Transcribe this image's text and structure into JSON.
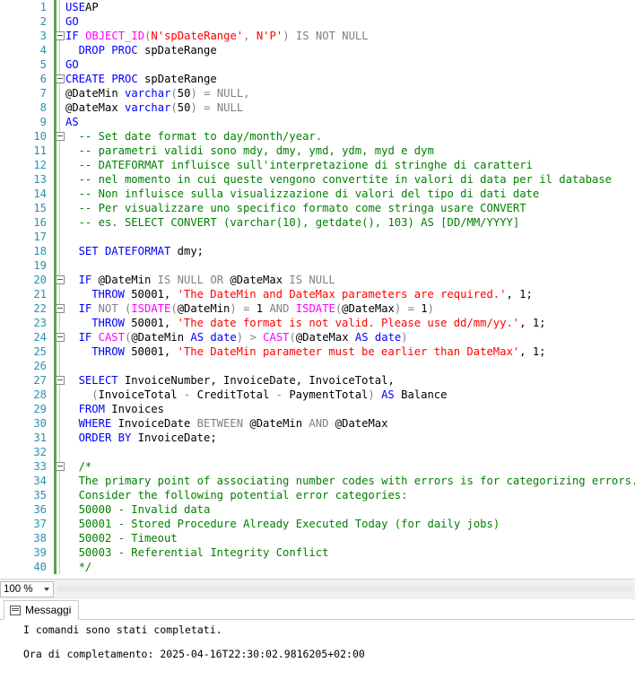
{
  "editor": {
    "lines": [
      {
        "num": "1",
        "fold": false,
        "segments": [
          [
            "kw",
            "USE"
          ],
          [
            "",
            "AP"
          ]
        ]
      },
      {
        "num": "2",
        "fold": false,
        "segments": [
          [
            "kw",
            "GO"
          ]
        ]
      },
      {
        "num": "3",
        "fold": true,
        "segments": [
          [
            "kw",
            "IF"
          ],
          [
            "",
            " "
          ],
          [
            "fn",
            "OBJECT_ID"
          ],
          [
            "gr",
            "("
          ],
          [
            "str",
            "N'spDateRange'"
          ],
          [
            "gr",
            ", "
          ],
          [
            "str",
            "N'P'"
          ],
          [
            "gr",
            ")"
          ],
          [
            "",
            " "
          ],
          [
            "gr",
            "IS NOT NULL"
          ]
        ]
      },
      {
        "num": "4",
        "fold": false,
        "segments": [
          [
            "",
            " "
          ],
          [
            "kw",
            "DROP PROC"
          ],
          [
            "",
            " spDateRange"
          ]
        ]
      },
      {
        "num": "5",
        "fold": false,
        "segments": [
          [
            "kw",
            "GO"
          ]
        ]
      },
      {
        "num": "6",
        "fold": true,
        "segments": [
          [
            "kw",
            "CREATE PROC"
          ],
          [
            "",
            " spDateRange"
          ]
        ]
      },
      {
        "num": "7",
        "fold": false,
        "segments": [
          [
            "",
            "@DateMin "
          ],
          [
            "kw",
            "varchar"
          ],
          [
            "gr",
            "("
          ],
          [
            "",
            "50"
          ],
          [
            "gr",
            ")"
          ],
          [
            "",
            " "
          ],
          [
            "gr",
            "="
          ],
          [
            "",
            " "
          ],
          [
            "gr",
            "NULL,"
          ]
        ]
      },
      {
        "num": "8",
        "fold": false,
        "segments": [
          [
            "",
            "@DateMax "
          ],
          [
            "kw",
            "varchar"
          ],
          [
            "gr",
            "("
          ],
          [
            "",
            "50"
          ],
          [
            "gr",
            ")"
          ],
          [
            "",
            " "
          ],
          [
            "gr",
            "="
          ],
          [
            "",
            " "
          ],
          [
            "gr",
            "NULL"
          ]
        ]
      },
      {
        "num": "9",
        "fold": false,
        "segments": [
          [
            "kw",
            "AS"
          ]
        ]
      },
      {
        "num": "10",
        "fold": true,
        "segments": [
          [
            "cm",
            " -- Set date format to day/month/year."
          ]
        ]
      },
      {
        "num": "11",
        "fold": false,
        "segments": [
          [
            "cm",
            " -- parametri validi sono mdy, dmy, ymd, ydm, myd e dym"
          ]
        ]
      },
      {
        "num": "12",
        "fold": false,
        "segments": [
          [
            "cm",
            " -- DATEFORMAT influisce sull'interpretazione di stringhe di caratteri"
          ]
        ]
      },
      {
        "num": "13",
        "fold": false,
        "segments": [
          [
            "cm",
            " -- nel momento in cui queste vengono convertite in valori di data per il database"
          ]
        ]
      },
      {
        "num": "14",
        "fold": false,
        "segments": [
          [
            "cm",
            " -- Non influisce sulla visualizzazione di valori del tipo di dati date"
          ]
        ]
      },
      {
        "num": "15",
        "fold": false,
        "segments": [
          [
            "cm",
            " -- Per visualizzare uno specifico formato come stringa usare CONVERT"
          ]
        ]
      },
      {
        "num": "16",
        "fold": false,
        "segments": [
          [
            "cm",
            " -- es. SELECT CONVERT (varchar(10), getdate(), 103) AS [DD/MM/YYYY]"
          ]
        ]
      },
      {
        "num": "17",
        "fold": false,
        "segments": []
      },
      {
        "num": "18",
        "fold": false,
        "segments": [
          [
            "",
            " "
          ],
          [
            "kw",
            "SET DATEFORMAT"
          ],
          [
            "",
            " dmy;"
          ]
        ]
      },
      {
        "num": "19",
        "fold": false,
        "segments": []
      },
      {
        "num": "20",
        "fold": true,
        "segments": [
          [
            "",
            " "
          ],
          [
            "kw",
            "IF"
          ],
          [
            "",
            " @DateMin "
          ],
          [
            "gr",
            "IS NULL OR"
          ],
          [
            "",
            " @DateMax "
          ],
          [
            "gr",
            "IS NULL"
          ]
        ]
      },
      {
        "num": "21",
        "fold": false,
        "segments": [
          [
            "",
            " "
          ],
          [
            "kw",
            "THROW"
          ],
          [
            "",
            " 50001, "
          ],
          [
            "str",
            "'The DateMin and DateMax parameters are required.'"
          ],
          [
            "",
            ", 1;"
          ]
        ]
      },
      {
        "num": "22",
        "fold": true,
        "segments": [
          [
            "",
            " "
          ],
          [
            "kw",
            "IF"
          ],
          [
            "",
            " "
          ],
          [
            "gr",
            "NOT ("
          ],
          [
            "fn",
            "ISDATE"
          ],
          [
            "gr",
            "("
          ],
          [
            "",
            "@DateMin"
          ],
          [
            "gr",
            ")"
          ],
          [
            "",
            " "
          ],
          [
            "gr",
            "="
          ],
          [
            "",
            " 1 "
          ],
          [
            "gr",
            "AND"
          ],
          [
            "",
            " "
          ],
          [
            "fn",
            "ISDATE"
          ],
          [
            "gr",
            "("
          ],
          [
            "",
            "@DateMax"
          ],
          [
            "gr",
            ")"
          ],
          [
            "",
            " "
          ],
          [
            "gr",
            "="
          ],
          [
            "",
            " 1"
          ],
          [
            "gr",
            ")"
          ]
        ]
      },
      {
        "num": "23",
        "fold": false,
        "segments": [
          [
            "",
            " "
          ],
          [
            "kw",
            "THROW"
          ],
          [
            "",
            " 50001, "
          ],
          [
            "str",
            "'The date format is not valid. Please use dd/mm/yy.'"
          ],
          [
            "",
            ", 1;"
          ]
        ]
      },
      {
        "num": "24",
        "fold": true,
        "segments": [
          [
            "",
            " "
          ],
          [
            "kw",
            "IF"
          ],
          [
            "",
            " "
          ],
          [
            "fn",
            "CAST"
          ],
          [
            "gr",
            "("
          ],
          [
            "",
            "@DateMin "
          ],
          [
            "kw",
            "AS"
          ],
          [
            "",
            " "
          ],
          [
            "kw",
            "date"
          ],
          [
            "gr",
            ")"
          ],
          [
            "",
            " "
          ],
          [
            "gr",
            ">"
          ],
          [
            "",
            " "
          ],
          [
            "fn",
            "CAST"
          ],
          [
            "gr",
            "("
          ],
          [
            "",
            "@DateMax "
          ],
          [
            "kw",
            "AS"
          ],
          [
            "",
            " "
          ],
          [
            "kw",
            "date"
          ],
          [
            "gr",
            ")"
          ]
        ]
      },
      {
        "num": "25",
        "fold": false,
        "segments": [
          [
            "",
            " "
          ],
          [
            "kw",
            "THROW"
          ],
          [
            "",
            " 50001, "
          ],
          [
            "str",
            "'The DateMin parameter must be earlier than DateMax'"
          ],
          [
            "",
            ", 1;"
          ]
        ]
      },
      {
        "num": "26",
        "fold": false,
        "segments": []
      },
      {
        "num": "27",
        "fold": true,
        "segments": [
          [
            "",
            " "
          ],
          [
            "kw",
            "SELECT"
          ],
          [
            "",
            " InvoiceNumber, InvoiceDate, InvoiceTotal,"
          ]
        ]
      },
      {
        "num": "28",
        "fold": false,
        "segments": [
          [
            "",
            " "
          ],
          [
            "gr",
            "("
          ],
          [
            "",
            "InvoiceTotal "
          ],
          [
            "gr",
            "-"
          ],
          [
            "",
            " CreditTotal "
          ],
          [
            "gr",
            "-"
          ],
          [
            "",
            " PaymentTotal"
          ],
          [
            "gr",
            ")"
          ],
          [
            "",
            " "
          ],
          [
            "kw",
            "AS"
          ],
          [
            "",
            " Balance"
          ]
        ]
      },
      {
        "num": "29",
        "fold": false,
        "segments": [
          [
            "",
            " "
          ],
          [
            "kw",
            "FROM"
          ],
          [
            "",
            " Invoices"
          ]
        ]
      },
      {
        "num": "30",
        "fold": false,
        "segments": [
          [
            "",
            " "
          ],
          [
            "kw",
            "WHERE"
          ],
          [
            "",
            " InvoiceDate "
          ],
          [
            "gr",
            "BETWEEN"
          ],
          [
            "",
            " @DateMin "
          ],
          [
            "gr",
            "AND"
          ],
          [
            "",
            " @DateMax"
          ]
        ]
      },
      {
        "num": "31",
        "fold": false,
        "segments": [
          [
            "",
            " "
          ],
          [
            "kw",
            "ORDER BY"
          ],
          [
            "",
            " InvoiceDate;"
          ]
        ]
      },
      {
        "num": "32",
        "fold": false,
        "segments": []
      },
      {
        "num": "33",
        "fold": true,
        "segments": [
          [
            "cm",
            " /*"
          ]
        ]
      },
      {
        "num": "34",
        "fold": false,
        "segments": [
          [
            "cm",
            " The primary point of associating number codes with errors is for categorizing errors."
          ]
        ]
      },
      {
        "num": "35",
        "fold": false,
        "segments": [
          [
            "cm",
            " Consider the following potential error categories:"
          ]
        ]
      },
      {
        "num": "36",
        "fold": false,
        "segments": [
          [
            "cm",
            " 50000 - Invalid data"
          ]
        ]
      },
      {
        "num": "37",
        "fold": false,
        "segments": [
          [
            "cm",
            " 50001 - Stored Procedure Already Executed Today (for daily jobs)"
          ]
        ]
      },
      {
        "num": "38",
        "fold": false,
        "segments": [
          [
            "cm",
            " 50002 - Timeout"
          ]
        ]
      },
      {
        "num": "39",
        "fold": false,
        "segments": [
          [
            "cm",
            " 50003 - Referential Integrity Conflict"
          ]
        ]
      },
      {
        "num": "40",
        "fold": false,
        "segments": [
          [
            "cm",
            " */"
          ]
        ]
      }
    ]
  },
  "zoom": {
    "value": "100 %"
  },
  "results": {
    "tab_label": "Messaggi",
    "messages": [
      "I comandi sono stati completati.",
      "",
      "Ora di completamento: 2025-04-16T22:30:02.9816205+02:00"
    ]
  },
  "colors": {
    "keyword": "#0000ff",
    "string": "#ff0000",
    "comment": "#008000",
    "operator": "#808080",
    "function": "#ff00ff",
    "line_number": "#2b91af",
    "change_bar": "#57a64a"
  }
}
